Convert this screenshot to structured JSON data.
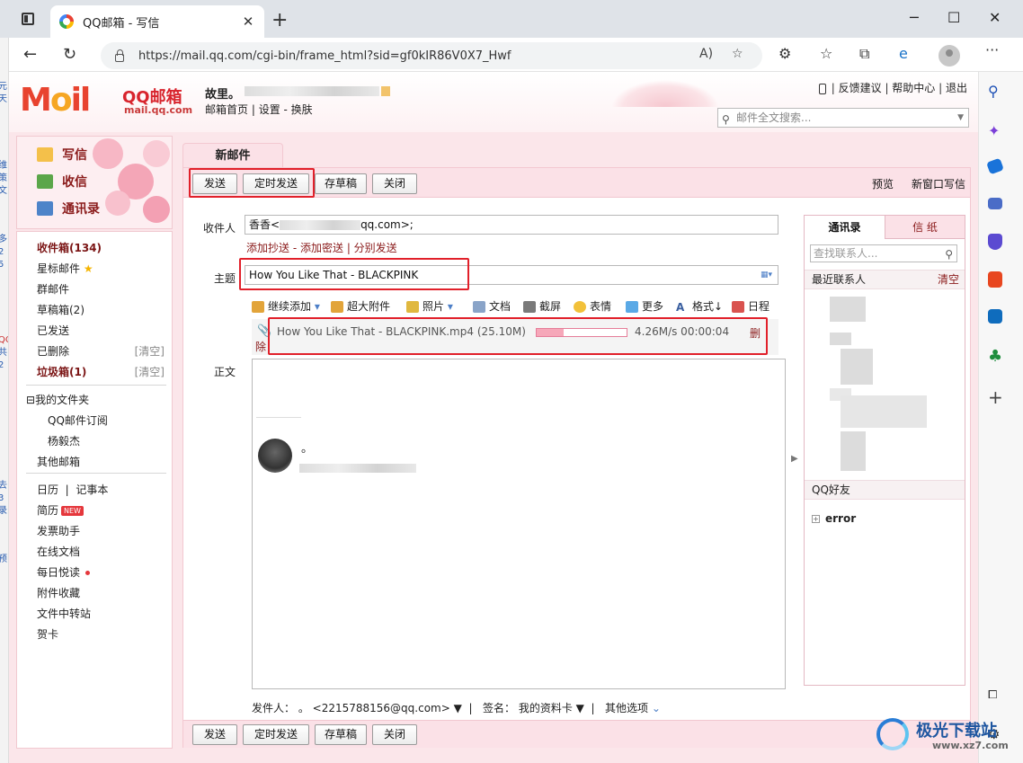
{
  "browser": {
    "tab_title": "QQ邮箱 - 写信",
    "url": "https://mail.qq.com/cgi-bin/frame_html?sid=gf0kIR86V0X7_Hwf"
  },
  "header": {
    "logo_text": "MOil",
    "brand_title": "QQ邮箱",
    "brand_domain": "mail.qq.com",
    "user_name": "故里。",
    "links": [
      "邮箱首页",
      "设置",
      "换肤"
    ],
    "top_links": [
      "反馈建议",
      "帮助中心",
      "退出"
    ],
    "search_placeholder": "邮件全文搜索..."
  },
  "sidebar": {
    "primary": [
      {
        "label": "写信",
        "icon": "compose-icon"
      },
      {
        "label": "收信",
        "icon": "inbox-download-icon"
      },
      {
        "label": "通讯录",
        "icon": "contacts-icon"
      }
    ],
    "folders": [
      {
        "label": "收件箱(134)"
      },
      {
        "label": "星标邮件"
      },
      {
        "label": "群邮件"
      },
      {
        "label": "草稿箱(2)"
      },
      {
        "label": "已发送"
      },
      {
        "label": "已删除",
        "action": "[清空]"
      },
      {
        "label": "垃圾箱(1)",
        "action": "[清空]"
      }
    ],
    "my_folders_label": "我的文件夹",
    "my_folders": [
      "QQ邮件订阅",
      "杨毅杰"
    ],
    "other_mailbox": "其他邮箱",
    "tools": {
      "calendar": "日历",
      "notebook": "记事本",
      "resume": "简历",
      "new_badge": "NEW",
      "invoice": "发票助手",
      "online_docs": "在线文档",
      "daily_reading": "每日悦读",
      "attachments": "附件收藏",
      "file_transfer": "文件中转站",
      "greeting_card": "贺卡"
    }
  },
  "compose": {
    "tab_label": "新邮件",
    "toolbar": {
      "send": "发送",
      "scheduled_send": "定时发送",
      "save_draft": "存草稿",
      "close": "关闭",
      "preview": "预览",
      "new_window": "新窗口写信"
    },
    "recipient_label": "收件人",
    "recipient_value_start": "香香<",
    "recipient_value_end": "qq.com>;",
    "recipient_links": [
      "添加抄送",
      "添加密送",
      "分别发送"
    ],
    "subject_label": "主题",
    "subject_value": "How You Like That - BLACKPINK",
    "attach_toolbar": [
      {
        "label": "继续添加",
        "icon": "paperclip-icon"
      },
      {
        "label": "超大附件",
        "icon": "large-attachment-icon"
      },
      {
        "label": "照片",
        "icon": "photo-icon"
      },
      {
        "label": "文档",
        "icon": "document-icon"
      },
      {
        "label": "截屏",
        "icon": "screenshot-icon"
      },
      {
        "label": "表情",
        "icon": "emoji-icon"
      },
      {
        "label": "更多",
        "icon": "more-icon"
      },
      {
        "label": "格式",
        "icon": "format-icon"
      },
      {
        "label": "日程",
        "icon": "calendar-icon"
      }
    ],
    "upload": {
      "file": "How You Like That - BLACKPINK.mp4 (25.10M)",
      "progress": 0.3,
      "speed": "4.26M/s 00:00:04",
      "delete_label_1": "删",
      "delete_label_2": "除"
    },
    "body_label": "正文",
    "signature_text": "。",
    "footer": {
      "sender_label": "发件人：",
      "sender_value": "。 <2215788156@qq.com>",
      "signature_label": "签名：",
      "signature_value": "我的资料卡",
      "other_options": "其他选项"
    }
  },
  "contacts_panel": {
    "tab_contacts": "通讯录",
    "tab_stationery": "信 纸",
    "search_placeholder": "查找联系人...",
    "recent_label": "最近联系人",
    "clear_label": "清空",
    "qq_friends_label": "QQ好友",
    "qq_group": "error"
  },
  "colors": {
    "accent_red": "#e1202a",
    "header_pink": "#fbe1e7",
    "link_dark_red": "#8a1a1a"
  },
  "watermark": {
    "text": "极光下载站",
    "url": "www.xz7.com"
  }
}
